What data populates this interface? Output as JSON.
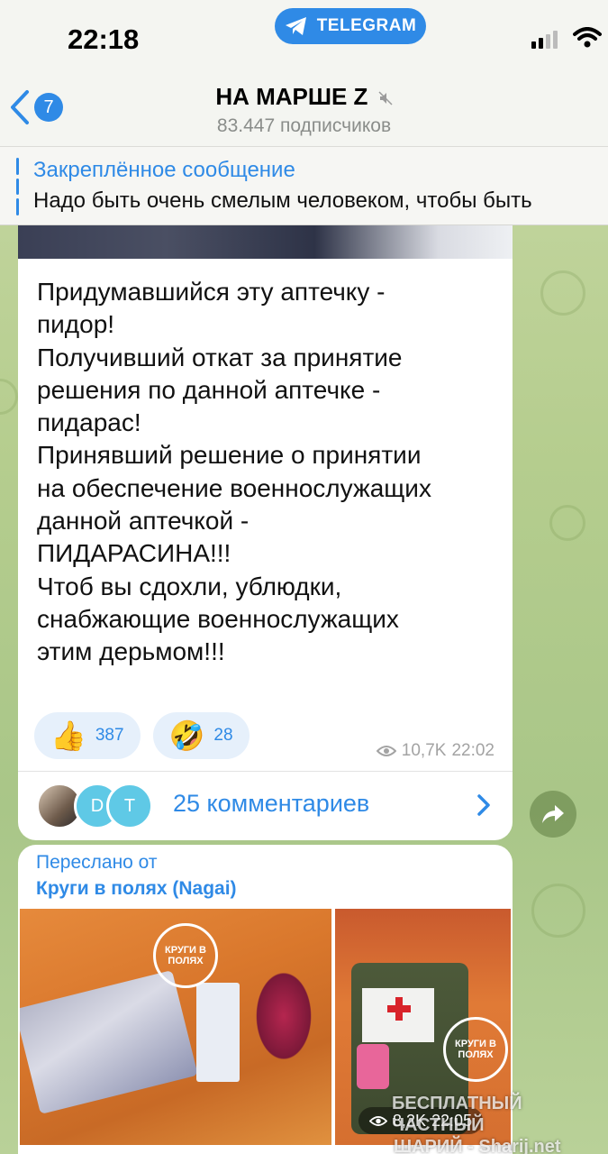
{
  "status_bar": {
    "time": "22:18",
    "app_pill": "TELEGRAM"
  },
  "header": {
    "back_count": "7",
    "title": "НА МАРШЕ Z",
    "subscribers": "83.447 подписчиков"
  },
  "pinned": {
    "title": "Закреплённое сообщение",
    "text": "Надо быть очень смелым человеком, чтобы быть"
  },
  "message1": {
    "text": "Придумавшийся эту аптечку -\nпидор!\nПолучивший откат за принятие\nрешения по данной аптечке -\nпидарас!\nПринявший решение о принятии\nна обеспечение военнослужащих\nданной аптечкой -\nПИДАРАСИНА!!!\nЧтоб вы сдохли, ублюдки,\nснабжающие военнослужащих\nэтим дерьмом!!!",
    "reactions": [
      {
        "emoji": "👍",
        "count": "387"
      },
      {
        "emoji": "🤣",
        "count": "28"
      }
    ],
    "views": "10,7K",
    "time": "22:02",
    "avatars": [
      "",
      "D",
      "T"
    ],
    "comments_label": "25 комментариев"
  },
  "message2": {
    "forwarded_label": "Переслано от",
    "forwarded_source": "Круги в полях (Nagai)",
    "logo_text": "КРУГИ В ПОЛЯХ",
    "views": "8,2K",
    "time": "22:05"
  },
  "watermark": {
    "line1": "БЕСПЛАТНЫЙ ЧАСТНЫЙ",
    "line2": "ШАРИЙ - Sharij.net"
  },
  "colors": {
    "accent": "#2f8ae6",
    "reaction_bg": "#e6f0fb"
  }
}
